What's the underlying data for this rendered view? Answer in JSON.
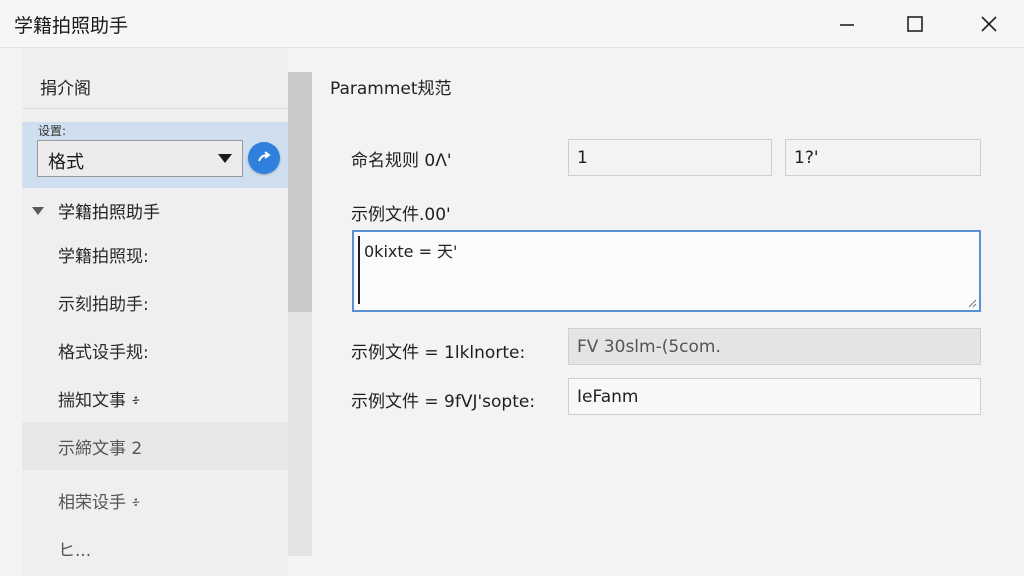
{
  "window": {
    "title": "学籍拍照助手",
    "controls": {
      "minimize_icon": "minimize-icon",
      "maximize_icon": "maximize-icon",
      "close_icon": "close-icon"
    }
  },
  "sidebar": {
    "header": "捐介阁",
    "settings_label": "设置:",
    "format_select": {
      "value": "格式"
    },
    "go_icon": "arrow-go-icon",
    "tree": {
      "root_label": "学籍拍照助手",
      "items": [
        {
          "label": "学籍拍照现:"
        },
        {
          "label": "示刻拍助手:"
        },
        {
          "label": "格式设手规:"
        },
        {
          "label": "揣知文事 ፥"
        },
        {
          "label": "示締文事 2"
        },
        {
          "label": "相荣设手 ፥"
        },
        {
          "label": "ヒ..."
        }
      ]
    }
  },
  "main": {
    "title": "Parammet规范",
    "naming_rule": {
      "label": "命名规则 0Λ'",
      "value1": "1",
      "value2": "1?'"
    },
    "example_file": {
      "label": "示例文件.00'",
      "text": "0kixte = 天'"
    },
    "example_row2": {
      "label": "示例文件 = 1lklnorte:",
      "value": "FV 30slm-(5com."
    },
    "example_row3": {
      "label": "示例文件 = 9fVJ'sopte:",
      "value": "IeFanm"
    }
  },
  "colors": {
    "accent": "#2f7fdc",
    "selection": "#cfdfef",
    "focus_border": "#5a8fd6"
  }
}
